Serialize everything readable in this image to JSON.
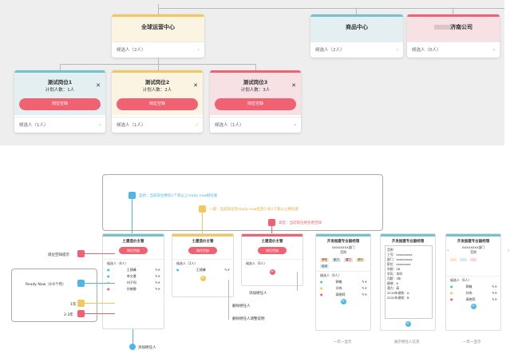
{
  "top": {
    "root": {
      "title": "全球运营中心",
      "candidates": "候选人（2人）"
    },
    "goods": {
      "title": "商品中心",
      "candidates": "候选人（2人）"
    },
    "company": {
      "title": "济南公司",
      "blurred_prefix": "",
      "candidates": "候选人（0人）"
    },
    "positions": [
      {
        "title": "测试岗位1",
        "plan": "计划人数：1人",
        "button": "岗位空缺",
        "candidates": "候选人（1人）",
        "color": "#75c1ce"
      },
      {
        "title": "测试岗位2",
        "plan": "计划人数：2人",
        "button": "岗位空缺",
        "candidates": "候选人（1人）",
        "color": "#f2c75f"
      },
      {
        "title": "测试岗位3",
        "plan": "计划人数：3人",
        "button": "岗位空缺",
        "candidates": "候选人（1人）",
        "color": "#f06272"
      }
    ]
  },
  "legend": {
    "blue": "蓝色：当前岗位拥有1个或以上ready now继任者",
    "yellow": "一般：当前岗位无ready now但至少有1个及以上继任者",
    "red": "高危：当前岗位继任者空缺"
  },
  "cards": [
    {
      "title": "土建造价主管",
      "button": "岗位空缺",
      "candidates": "候选人（4人）",
      "people": [
        "王建峰",
        "李文雅",
        "刘子同",
        "孙晓静"
      ],
      "color": "#75c1ce"
    },
    {
      "title": "土建造价主管",
      "button": "岗位空缺",
      "candidates": "候选人（1人）",
      "people": [
        "王建峰"
      ],
      "color": "#f2c75f"
    },
    {
      "title": "土建造价主管",
      "button": "岗位空缺",
      "candidates": "候选人（0人）",
      "people": [],
      "color": "#f06272"
    }
  ],
  "annotations": {
    "post_vacancy": "岗位空缺提示",
    "ready_now": "Ready Now（0-6个月）",
    "one_year": "1年",
    "two_three": "2-3年",
    "add_candidate": "添加继任人",
    "delete_candidate": "删除继任人",
    "adjust_candidate": "删除继任人调整说明",
    "bottom_add": "添加继任人"
  },
  "detail_cards": [
    {
      "title": "开发报建专业副经理",
      "dept": "XXXXXXXX部门",
      "sub": "范例",
      "candidates": "候选人（0人）",
      "footer": "一年一显示",
      "tags": [
        "绩效",
        "能力",
        "潜力",
        "资历",
        "培训"
      ]
    },
    {
      "title": "开发报建专业副经理",
      "dept": "XXXXXXXX部门",
      "sub": "范例",
      "candidates": "",
      "footer": "展示继任人信息",
      "tags": []
    },
    {
      "title": "开发报建专业副经理",
      "dept": "XXXXXXXX部门",
      "sub": "范例",
      "candidates": "候选人（0人）",
      "footer": "一年一显示",
      "tags": []
    }
  ],
  "detail_people": [
    "郭敏",
    "孙伟",
    "高晓莉"
  ],
  "popup": {
    "name": "范例",
    "lines": [
      "工号：xxxxxxxxx",
      "部门：xxxxxxxxx",
      "职位：xxxxxxxx",
      "年龄：28",
      "学历：本科",
      "司龄：3年",
      "绩效：A",
      "潜力：高",
      "2019年绩效：A",
      "2020年绩效：B"
    ]
  }
}
